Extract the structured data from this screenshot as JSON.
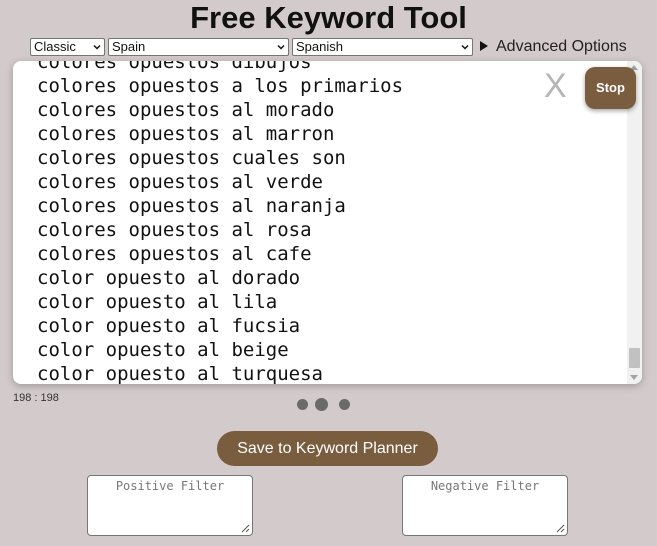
{
  "header": {
    "title": "Free Keyword Tool"
  },
  "toolbar": {
    "mode_select": "Classic",
    "country_select": "Spain",
    "language_select": "Spanish",
    "advanced_label": "Advanced Options"
  },
  "results": {
    "keywords": [
      "colores opuestos dibujos",
      "colores opuestos a los primarios",
      "colores opuestos al morado",
      "colores opuestos al marron",
      "colores opuestos cuales son",
      "colores opuestos al verde",
      "colores opuestos al naranja",
      "colores opuestos al rosa",
      "colores opuestos al cafe",
      "color opuesto al dorado",
      "color opuesto al lila",
      "color opuesto al fucsia",
      "color opuesto al beige",
      "color opuesto al turquesa"
    ],
    "close_label": "X",
    "stop_label": "Stop",
    "count_text": "198 : 198"
  },
  "actions": {
    "save_label": "Save to Keyword Planner"
  },
  "filters": {
    "positive_placeholder": "Positive Filter",
    "negative_placeholder": "Negative Filter"
  },
  "colors": {
    "accent": "#7a5c3e",
    "background": "#d3cbcb",
    "loading_dot": "#6a6a6a"
  },
  "icons": {
    "advanced": "triangle-right-icon",
    "close": "close-icon",
    "loading": "loading-dots-icon"
  }
}
